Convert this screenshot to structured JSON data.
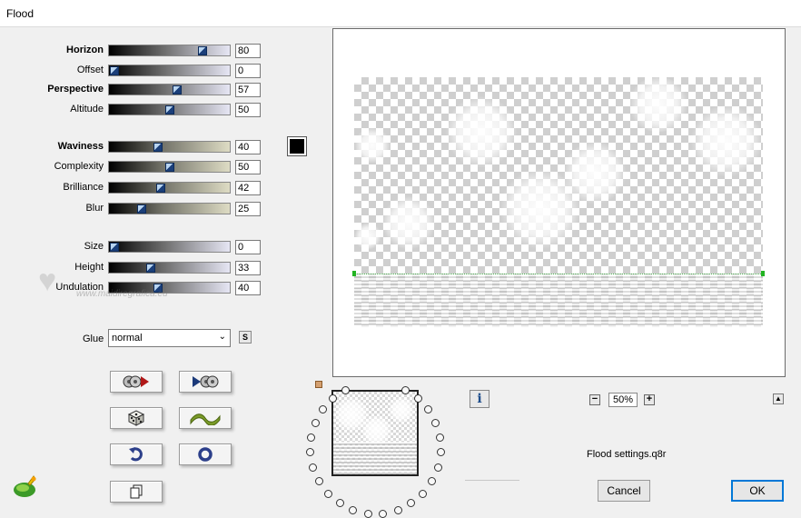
{
  "window": {
    "title": "Flood"
  },
  "sliders": [
    {
      "label": "Horizon",
      "value": "80",
      "bold": true,
      "gradient": "gray",
      "level": 0.8
    },
    {
      "label": "Offset",
      "value": "0",
      "bold": false,
      "gradient": "gray",
      "level": 0.0
    },
    {
      "label": "Perspective",
      "value": "57",
      "bold": true,
      "gradient": "gray",
      "level": 0.57
    },
    {
      "label": "Altitude",
      "value": "50",
      "bold": false,
      "gradient": "gray",
      "level": 0.5
    },
    {
      "label": "Waviness",
      "value": "40",
      "bold": true,
      "gradient": "cream",
      "level": 0.4
    },
    {
      "label": "Complexity",
      "value": "50",
      "bold": false,
      "gradient": "cream",
      "level": 0.5
    },
    {
      "label": "Brilliance",
      "value": "42",
      "bold": false,
      "gradient": "cream",
      "level": 0.42
    },
    {
      "label": "Blur",
      "value": "25",
      "bold": false,
      "gradient": "cream",
      "level": 0.25
    },
    {
      "label": "Size",
      "value": "0",
      "bold": false,
      "gradient": "gray",
      "level": 0.0
    },
    {
      "label": "Height",
      "value": "33",
      "bold": false,
      "gradient": "gray",
      "level": 0.33
    },
    {
      "label": "Undulation",
      "value": "40",
      "bold": false,
      "gradient": "gray",
      "level": 0.4
    }
  ],
  "color_swatch": "#000000",
  "watermark": {
    "text": "www.maidiregrafica.eu"
  },
  "glue": {
    "label": "Glue",
    "value": "normal"
  },
  "s_button": "S",
  "preview": {
    "zoom": "50%"
  },
  "info_label": "i",
  "settings_file": "Flood settings.q8r",
  "buttons": {
    "cancel": "Cancel",
    "ok": "OK"
  },
  "icons": [
    "reset-to-default-icon",
    "next-preset-icon",
    "randomize-dice-icon",
    "wave-icon",
    "undo-icon",
    "circle-icon",
    "copy-icon",
    "program-logo-icon"
  ]
}
